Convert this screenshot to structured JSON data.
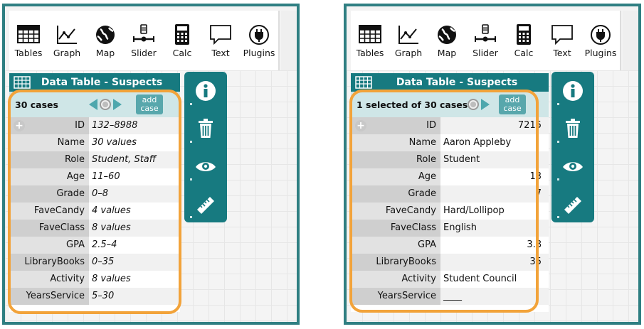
{
  "toolbar": {
    "tools": [
      {
        "label": "Tables",
        "icon": "table-icon"
      },
      {
        "label": "Graph",
        "icon": "graph-icon"
      },
      {
        "label": "Map",
        "icon": "globe-icon"
      },
      {
        "label": "Slider",
        "icon": "slider-icon"
      },
      {
        "label": "Calc",
        "icon": "calculator-icon"
      },
      {
        "label": "Text",
        "icon": "speech-bubble-icon"
      },
      {
        "label": "Plugins",
        "icon": "plug-icon"
      }
    ]
  },
  "left": {
    "title": "Data Table - Suspects",
    "case_count": "30 cases",
    "add_case": "add case",
    "rows": [
      {
        "key": "ID",
        "value": "132–8988"
      },
      {
        "key": "Name",
        "value": "30 values"
      },
      {
        "key": "Role",
        "value": "Student, Staff"
      },
      {
        "key": "Age",
        "value": "11–60"
      },
      {
        "key": "Grade",
        "value": "0–8"
      },
      {
        "key": "FaveCandy",
        "value": "4 values"
      },
      {
        "key": "FaveClass",
        "value": "8 values"
      },
      {
        "key": "GPA",
        "value": "2.5–4"
      },
      {
        "key": "LibraryBooks",
        "value": "0–35"
      },
      {
        "key": "Activity",
        "value": "8 values"
      },
      {
        "key": "YearsService",
        "value": "5–30"
      }
    ]
  },
  "right": {
    "title": "Data Table - Suspects",
    "case_count": "1 selected of 30 cases",
    "add_case": "add case",
    "rows": [
      {
        "key": "ID",
        "value": "7215"
      },
      {
        "key": "Name",
        "value": "Aaron Appleby"
      },
      {
        "key": "Role",
        "value": "Student"
      },
      {
        "key": "Age",
        "value": "13"
      },
      {
        "key": "Grade",
        "value": "7"
      },
      {
        "key": "FaveCandy",
        "value": "Hard/Lollipop"
      },
      {
        "key": "FaveClass",
        "value": "English"
      },
      {
        "key": "GPA",
        "value": "3.8"
      },
      {
        "key": "LibraryBooks",
        "value": "35"
      },
      {
        "key": "Activity",
        "value": "Student Council"
      },
      {
        "key": "YearsService",
        "value": "____"
      }
    ]
  },
  "side_tools": [
    "info-icon",
    "trash-icon",
    "eye-icon",
    "ruler-icon"
  ],
  "colors": {
    "teal": "#177a80",
    "frame": "#2f7f82",
    "highlight": "#f2a33a",
    "case_bar": "#cfe6e7"
  }
}
